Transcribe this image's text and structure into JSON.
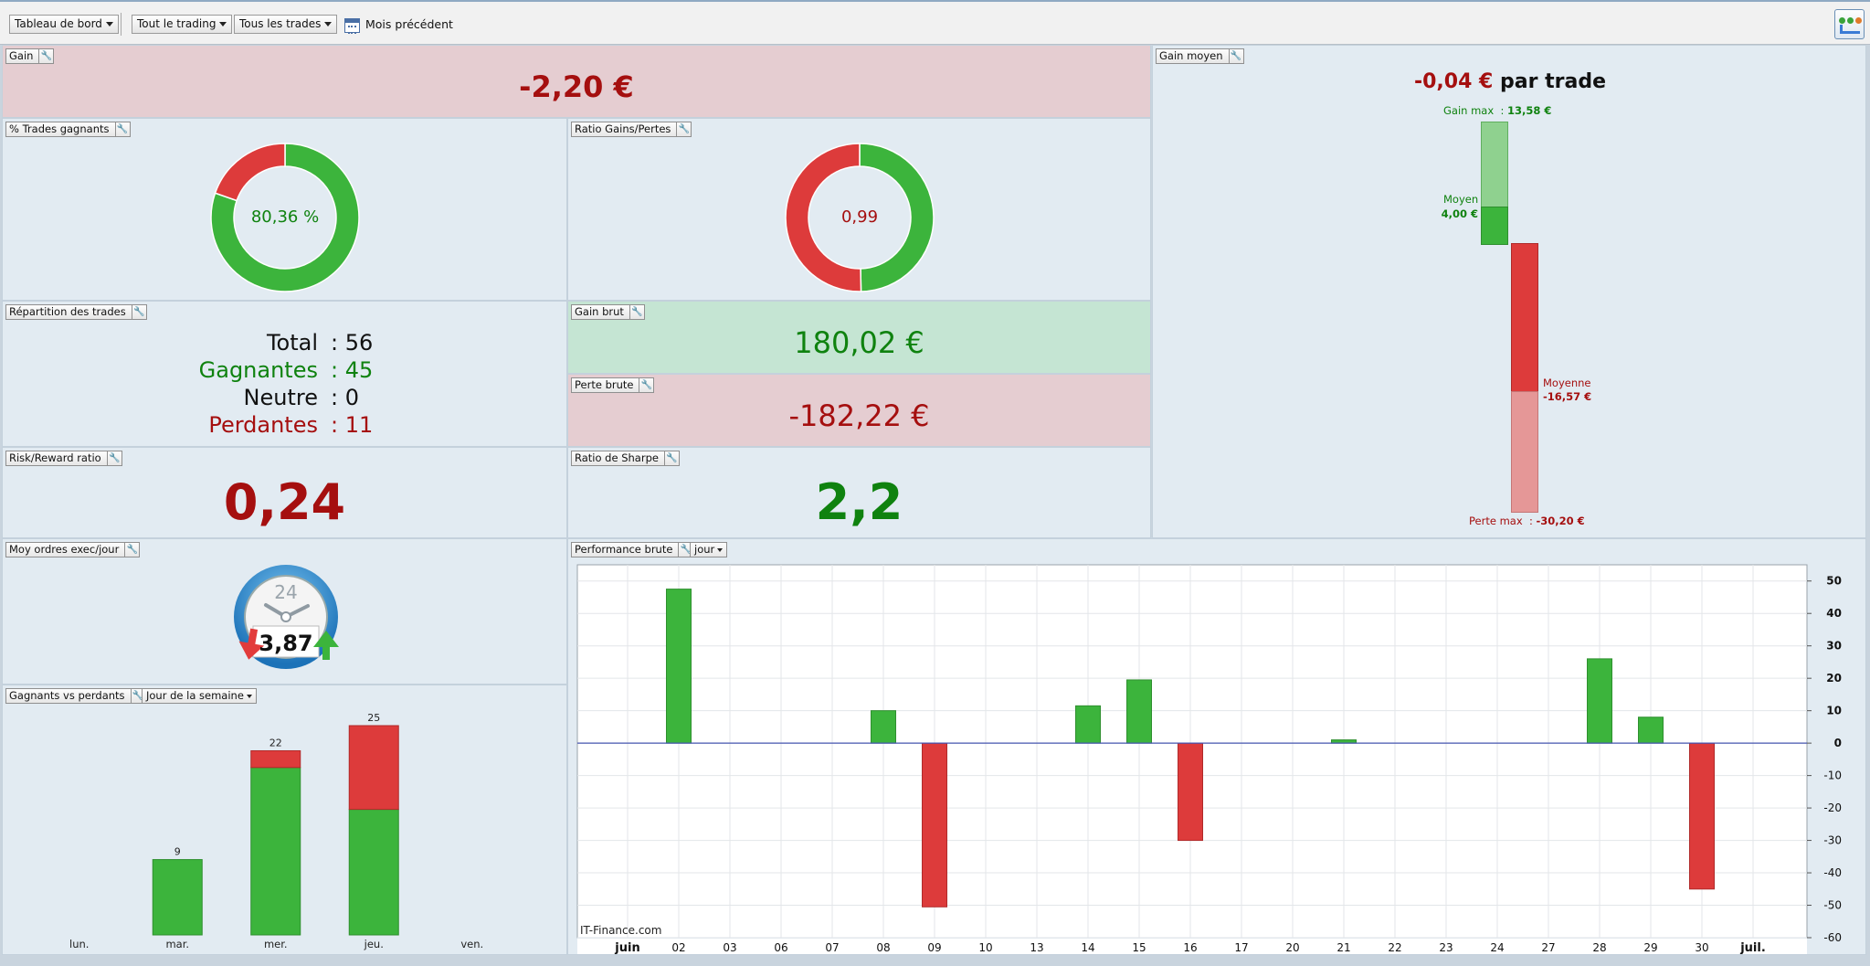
{
  "toolbar": {
    "dashboard_label": "Tableau de bord",
    "trading_label": "Tout le trading",
    "trades_label": "Tous les trades",
    "period_label": "Mois précédent",
    "app_icon": "trading-app-icon"
  },
  "colors": {
    "positive": "#3cb43c",
    "negative": "#dd3b3b",
    "positive_text": "#0f820f",
    "negative_text": "#a50f0f",
    "panel_bg": "#e2ebf2"
  },
  "gain": {
    "title": "Gain",
    "value": "-2,20 €"
  },
  "pct_winning": {
    "title": "% Trades gagnants",
    "label": "80,36 %",
    "fraction": 0.8036
  },
  "ratio_gp": {
    "title": "Ratio Gains/Pertes",
    "label": "0,99",
    "fraction_green": 0.497
  },
  "repartition": {
    "title": "Répartition des trades",
    "rows": [
      {
        "label": "Total",
        "value": ": 56"
      },
      {
        "label": "Gagnantes",
        "value": ": 45"
      },
      {
        "label": "Neutre",
        "value": ": 0"
      },
      {
        "label": "Perdantes",
        "value": ": 11"
      }
    ]
  },
  "gross_gain": {
    "title": "Gain brut",
    "value": "180,02 €"
  },
  "gross_loss": {
    "title": "Perte brute",
    "value": "-182,22 €"
  },
  "risk_reward": {
    "title": "Risk/Reward ratio",
    "value": "0,24"
  },
  "sharpe": {
    "title": "Ratio de Sharpe",
    "value": "2,2"
  },
  "avg_gain": {
    "title": "Gain moyen",
    "value": "-0,04 €",
    "suffix": "par trade",
    "gain_max_label": "Gain max",
    "gain_max_sep": ":",
    "gain_max_value": "13,58 €",
    "avg_label": "Moyen",
    "avg_value": "4,00 €",
    "avgloss_label": "Moyenne",
    "avgloss_value": "-16,57 €",
    "loss_max_label": "Perte max",
    "loss_max_sep": ":",
    "loss_max_value": "-30,20 €"
  },
  "orders": {
    "title": "Moy ordres exec/jour",
    "value": "3,87",
    "clock_number": "24"
  },
  "winners_losers": {
    "title": "Gagnants vs perdants",
    "dropdown": "Jour de la semaine"
  },
  "performance": {
    "title": "Performance brute",
    "dropdown": "jour",
    "watermark": "IT-Finance.com"
  },
  "chart_data": [
    {
      "type": "bar",
      "title": "Gagnants vs perdants",
      "categories": [
        "lun.",
        "mar.",
        "mer.",
        "jeu.",
        "ven."
      ],
      "series": [],
      "winners": [
        0,
        9,
        20,
        15,
        0
      ],
      "losers": [
        0,
        0,
        2,
        10,
        0
      ],
      "totals": [
        0,
        9,
        22,
        25,
        0
      ],
      "total_labels": [
        "",
        "9",
        "22",
        "25",
        ""
      ],
      "ylim": [
        0,
        25
      ]
    },
    {
      "type": "bar",
      "title": "Performance brute",
      "x_labels": [
        "juin",
        "02",
        "03",
        "06",
        "07",
        "08",
        "09",
        "10",
        "13",
        "14",
        "15",
        "16",
        "17",
        "20",
        "21",
        "22",
        "23",
        "24",
        "27",
        "28",
        "29",
        "30",
        "juil."
      ],
      "values": [
        0,
        47.5,
        0,
        0,
        0,
        10,
        -50.5,
        0,
        0,
        11.5,
        19.5,
        -30,
        0,
        0,
        1,
        0,
        0,
        0,
        0,
        26,
        8,
        -45,
        0
      ],
      "ylim": [
        -60,
        55
      ],
      "yticks": [
        50,
        40,
        30,
        20,
        10,
        0,
        -10,
        -20,
        -30,
        -40,
        -50,
        -60
      ],
      "grid": true
    }
  ]
}
